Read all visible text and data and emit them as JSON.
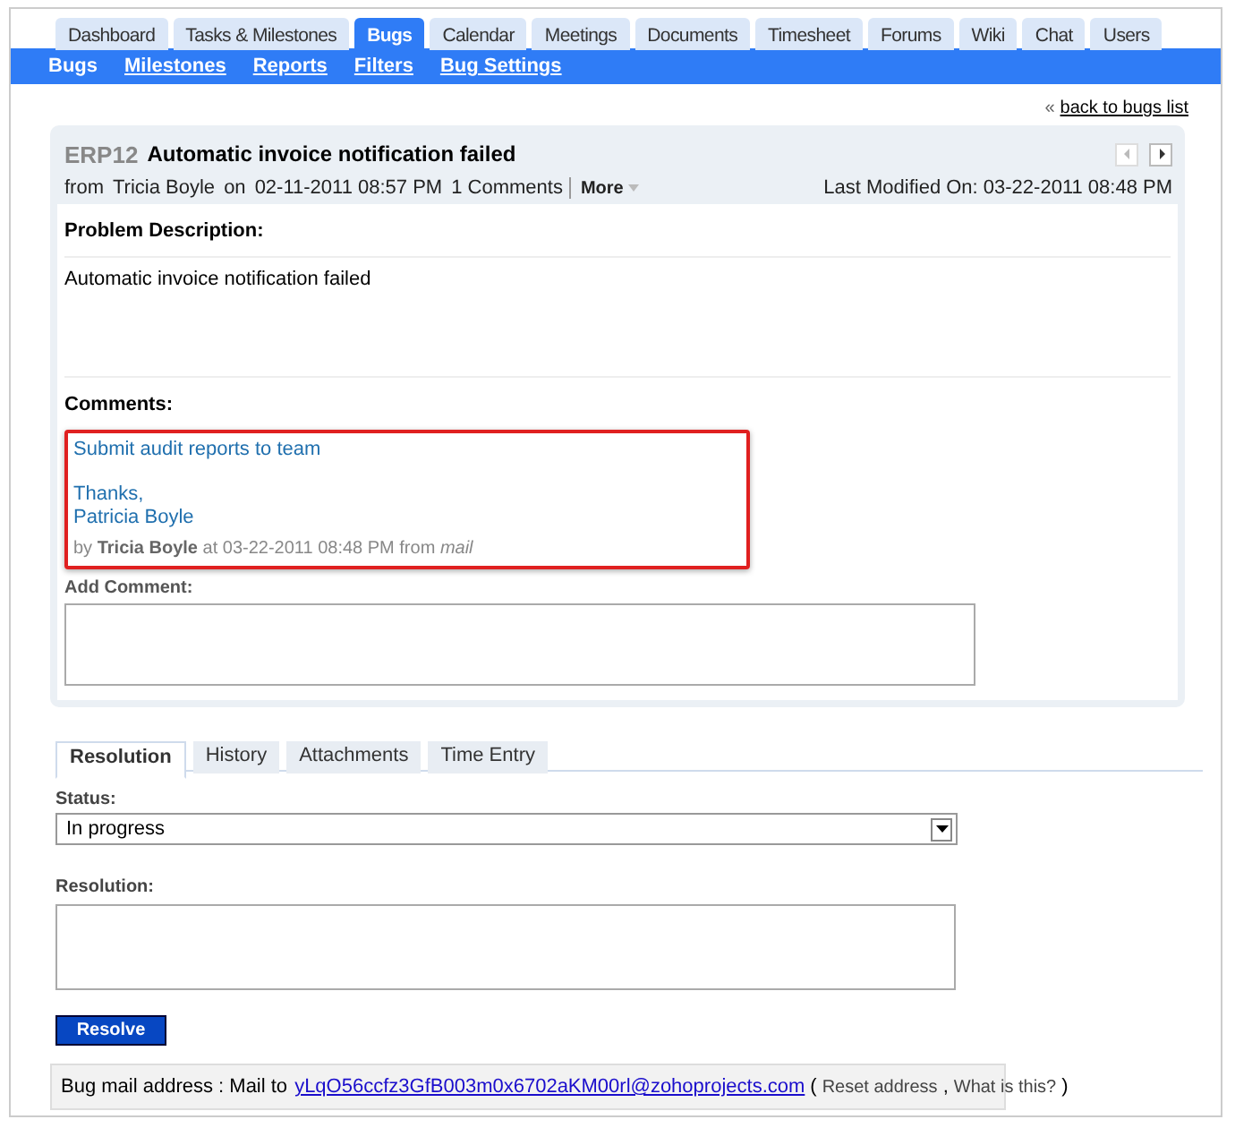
{
  "main_tabs": [
    {
      "label": "Dashboard",
      "selected": false
    },
    {
      "label": "Tasks & Milestones",
      "selected": false
    },
    {
      "label": "Bugs",
      "selected": true
    },
    {
      "label": "Calendar",
      "selected": false
    },
    {
      "label": "Meetings",
      "selected": false
    },
    {
      "label": "Documents",
      "selected": false
    },
    {
      "label": "Timesheet",
      "selected": false
    },
    {
      "label": "Forums",
      "selected": false
    },
    {
      "label": "Wiki",
      "selected": false
    },
    {
      "label": "Chat",
      "selected": false
    },
    {
      "label": "Users",
      "selected": false
    }
  ],
  "sub_tabs": [
    {
      "label": "Bugs",
      "selected": true
    },
    {
      "label": "Milestones",
      "selected": false
    },
    {
      "label": "Reports",
      "selected": false
    },
    {
      "label": "Filters",
      "selected": false
    },
    {
      "label": "Bug Settings",
      "selected": false
    }
  ],
  "back_link": {
    "mark": "«",
    "label": "back to bugs list"
  },
  "bug": {
    "id": "ERP12",
    "title": "Automatic invoice notification failed",
    "from_label": "from",
    "reporter": "Tricia Boyle",
    "on_label": "on",
    "created": "02-11-2011 08:57 PM",
    "comments_count": "1 Comments",
    "more": "More",
    "last_modified": "Last Modified On: 03-22-2011 08:48 PM",
    "description_heading": "Problem Description:",
    "description": "Automatic invoice notification failed",
    "comments_heading": "Comments:",
    "comments": [
      {
        "paragraphs": [
          [
            "Submit audit reports to team"
          ],
          [
            "Thanks,",
            "Patricia Boyle"
          ]
        ],
        "meta": "by **Tricia Boyle** at 03-22-2011 08:48 PM from *mail*",
        "highlighted": true
      }
    ],
    "add_comment_label": "Add Comment:"
  },
  "detail_tabs": [
    {
      "label": "Resolution",
      "selected": true
    },
    {
      "label": "History",
      "selected": false
    },
    {
      "label": "Attachments",
      "selected": false
    },
    {
      "label": "Time Entry",
      "selected": false
    }
  ],
  "status": {
    "label": "Status:",
    "value": "In progress"
  },
  "resolution": {
    "label": "Resolution:"
  },
  "resolve_button": "Resolve",
  "mail_bar": {
    "text": "Bug mail address : Mail to",
    "address": "yLqO56ccfz3GfB003m0x6702aKM00rl@zohoprojects.com",
    "open": "(",
    "reset": "Reset address",
    "separator": ",",
    "help": "What is this?",
    "close": ")"
  }
}
